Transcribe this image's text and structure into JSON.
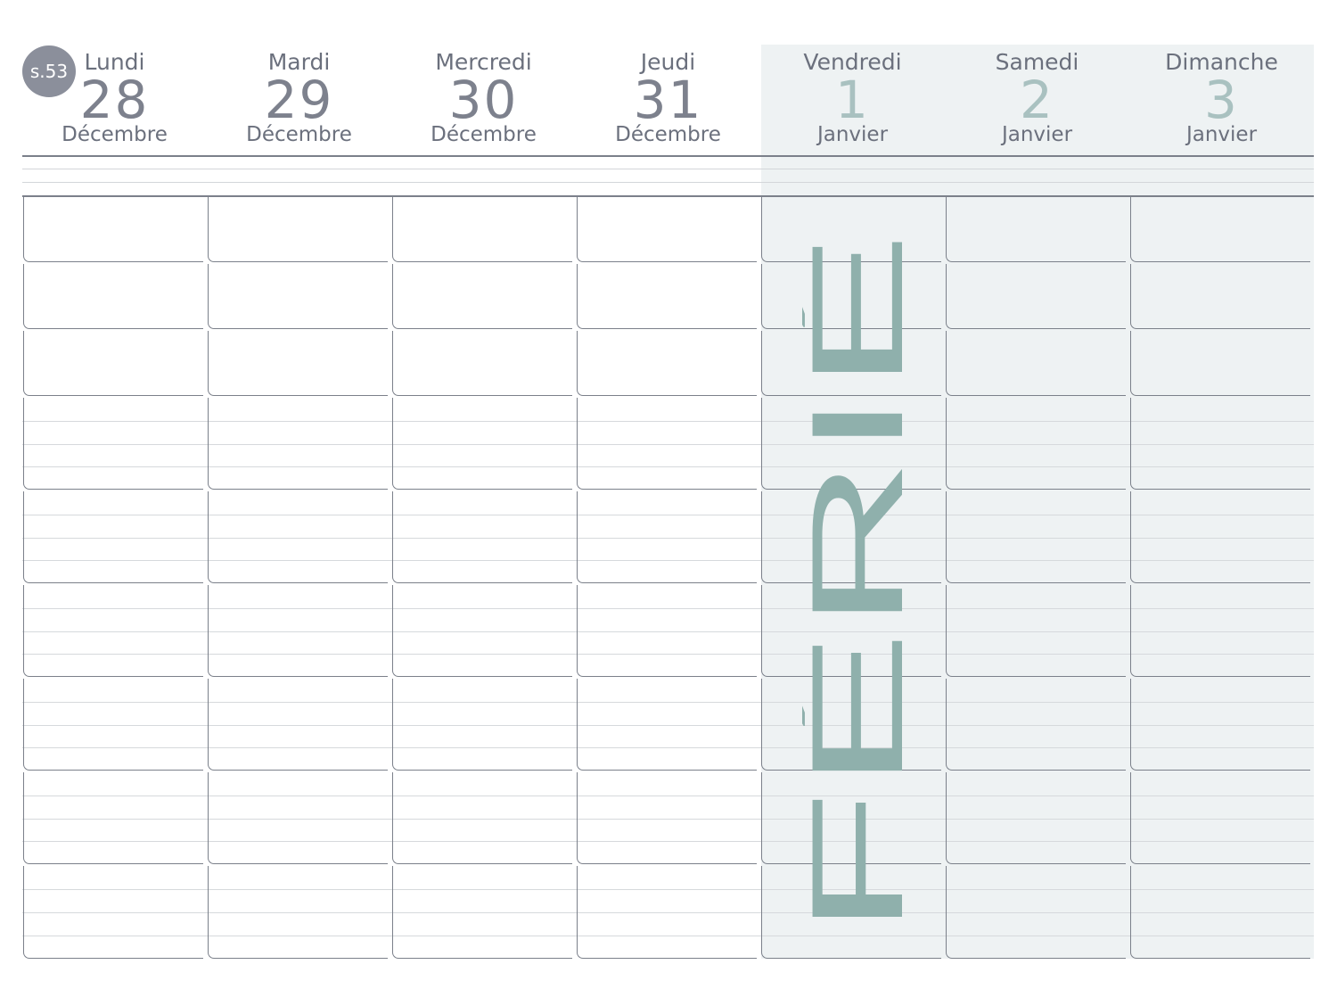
{
  "week": {
    "label": "s.53"
  },
  "days": [
    {
      "name": "Lundi",
      "number": "28",
      "month": "Décembre",
      "holiday": false
    },
    {
      "name": "Mardi",
      "number": "29",
      "month": "Décembre",
      "holiday": false
    },
    {
      "name": "Mercredi",
      "number": "30",
      "month": "Décembre",
      "holiday": false
    },
    {
      "name": "Jeudi",
      "number": "31",
      "month": "Décembre",
      "holiday": false
    },
    {
      "name": "Vendredi",
      "number": "1",
      "month": "Janvier",
      "holiday": true
    },
    {
      "name": "Samedi",
      "number": "2",
      "month": "Janvier",
      "holiday": false
    },
    {
      "name": "Dimanche",
      "number": "3",
      "month": "Janvier",
      "holiday": false
    }
  ],
  "holiday_label": "FÉRIÉ",
  "colors": {
    "weekend_shade": "#eef2f3",
    "holiday_text": "#8fb0ac",
    "holiday_number": "#a9c1c0",
    "grid_line": "#7b808a",
    "badge": "#8b8f9b"
  },
  "rows": {
    "count": 9,
    "ruled_lines_per_row": [
      0,
      0,
      0,
      3,
      3,
      3,
      3,
      3,
      3
    ]
  }
}
